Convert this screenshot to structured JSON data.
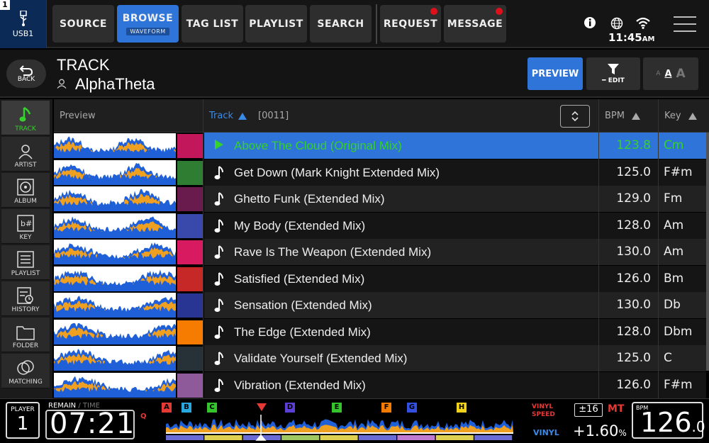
{
  "deck_badge": "1",
  "usb_label": "USB1",
  "tabs": [
    {
      "label": "SOURCE"
    },
    {
      "label": "BROWSE",
      "sub": "WAVEFORM"
    },
    {
      "label": "TAG LIST"
    },
    {
      "label": "PLAYLIST"
    },
    {
      "label": "SEARCH"
    },
    {
      "label": "REQUEST"
    },
    {
      "label": "MESSAGE"
    }
  ],
  "clock": {
    "time": "11:45",
    "ampm": "AM"
  },
  "back_label": "BACK",
  "header": {
    "title": "TRACK",
    "subtitle": "AlphaTheta"
  },
  "buttons": {
    "preview": "PREVIEW",
    "edit": "EDIT",
    "font_small": "A",
    "font_mid": "A",
    "font_big": "A"
  },
  "sidebar": [
    {
      "label": "TRACK",
      "icon": "music-note-icon"
    },
    {
      "label": "ARTIST",
      "icon": "person-icon"
    },
    {
      "label": "ALBUM",
      "icon": "disc-icon"
    },
    {
      "label": "KEY",
      "icon": "key-icon"
    },
    {
      "label": "PLAYLIST",
      "icon": "list-icon"
    },
    {
      "label": "HISTORY",
      "icon": "history-icon"
    },
    {
      "label": "FOLDER",
      "icon": "folder-icon"
    },
    {
      "label": "MATCHING",
      "icon": "matching-icon"
    }
  ],
  "columns": {
    "preview": "Preview",
    "track": "Track",
    "count": "[0011]",
    "bpm": "BPM",
    "key": "Key"
  },
  "tracks": [
    {
      "name": "Above The Cloud (Original Mix)",
      "bpm": "123.8",
      "key": "Cm",
      "art": "#c2185b"
    },
    {
      "name": "Get Down (Mark Knight Extended Mix)",
      "bpm": "125.0",
      "key": "F#m",
      "art": "#2e7d32"
    },
    {
      "name": "Ghetto Funk (Extended Mix)",
      "bpm": "129.0",
      "key": "Fm",
      "art": "#6a1b4d"
    },
    {
      "name": "My Body (Extended Mix)",
      "bpm": "128.0",
      "key": "Am",
      "art": "#3949ab"
    },
    {
      "name": "Rave Is The Weapon (Extended Mix)",
      "bpm": "130.0",
      "key": "Am",
      "art": "#d81b60"
    },
    {
      "name": "Satisfied (Extended Mix)",
      "bpm": "126.0",
      "key": "Bm",
      "art": "#c62828"
    },
    {
      "name": "Sensation (Extended Mix)",
      "bpm": "130.0",
      "key": "Db",
      "art": "#283593"
    },
    {
      "name": "The Edge (Extended Mix)",
      "bpm": "128.0",
      "key": "Dbm",
      "art": "#f57c00"
    },
    {
      "name": "Validate Yourself (Extended Mix)",
      "bpm": "125.0",
      "key": "C",
      "art": "#263238"
    },
    {
      "name": "Vibration (Extended Mix)",
      "bpm": "126.0",
      "key": "F#m",
      "art": "#8e5a9a"
    }
  ],
  "deck": {
    "player_label": "PLAYER",
    "player_num": "1",
    "remain_label": "REMAIN",
    "time_label": "TIME",
    "time": "07:21",
    "q_label": "Q",
    "cues": [
      {
        "label": "A",
        "color": "#e53935"
      },
      {
        "label": "B",
        "color": "#29a8e0"
      },
      {
        "label": "C",
        "color": "#35c42c"
      },
      {
        "label": "D",
        "color": "#5b3fd6"
      },
      {
        "label": "E",
        "color": "#35c42c"
      },
      {
        "label": "F",
        "color": "#f57c00"
      },
      {
        "label": "G",
        "color": "#3350e0"
      },
      {
        "label": "H",
        "color": "#f2d21b"
      }
    ],
    "vinyl_speed_label": "VINYL\nSPEED",
    "vinyl_label": "VINYL",
    "range": "±16",
    "mt": "MT",
    "pitch": "+1.60",
    "pitch_unit": "%",
    "bpm_label": "BPM",
    "bpm_int": "126",
    "bpm_dec": ".0"
  }
}
